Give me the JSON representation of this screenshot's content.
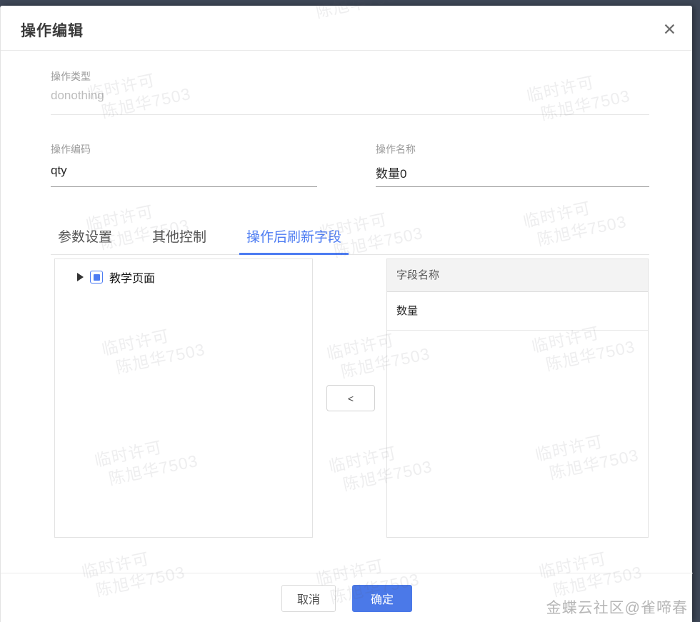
{
  "dialog": {
    "title": "操作编辑",
    "close_icon": "✕"
  },
  "form": {
    "operation_type": {
      "label": "操作类型",
      "value": "donothing"
    },
    "operation_code": {
      "label": "操作编码",
      "value": "qty"
    },
    "operation_name": {
      "label": "操作名称",
      "value": "数量0"
    }
  },
  "tabs": [
    {
      "label": "参数设置",
      "active": false
    },
    {
      "label": "其他控制",
      "active": false
    },
    {
      "label": "操作后刷新字段",
      "active": true
    }
  ],
  "tree": {
    "node_label": "教学页面"
  },
  "transfer": {
    "move_left_label": "<"
  },
  "field_table": {
    "header": "字段名称",
    "rows": [
      "数量"
    ]
  },
  "footer": {
    "cancel_label": "取消",
    "confirm_label": "确定"
  },
  "watermark": {
    "line1": "临时许可",
    "line2": "陈旭华7503"
  },
  "credit": "金蝶云社区@雀啼春",
  "colors": {
    "accent_blue": "#4d7cf2",
    "confirm_blue": "#4b79e8",
    "chrome_navy": "#3e4757"
  }
}
